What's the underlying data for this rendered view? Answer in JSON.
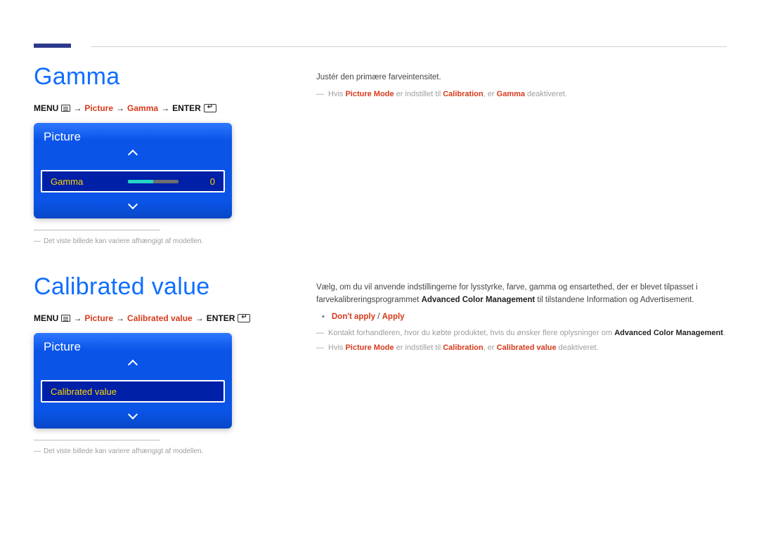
{
  "section_gamma": {
    "title": "Gamma",
    "breadcrumb": {
      "menu": "MENU",
      "picture": "Picture",
      "item": "Gamma",
      "enter": "ENTER"
    },
    "osd": {
      "header": "Picture",
      "row_label": "Gamma",
      "value": "0"
    },
    "note": "Det viste billede kan variere afhængigt af modellen.",
    "body": {
      "p1": "Justér den primære farveintensitet.",
      "fn_pre": "Hvis ",
      "fn_pm": "Picture Mode",
      "fn_mid1": " er indstillet til ",
      "fn_cal": "Calibration",
      "fn_mid2": ", er ",
      "fn_g": "Gamma",
      "fn_end": " deaktiveret."
    }
  },
  "section_calibrated": {
    "title": "Calibrated value",
    "breadcrumb": {
      "menu": "MENU",
      "picture": "Picture",
      "item": "Calibrated value",
      "enter": "ENTER"
    },
    "osd": {
      "header": "Picture",
      "row_label": "Calibrated value"
    },
    "note": "Det viste billede kan variere afhængigt af modellen.",
    "body": {
      "p1a": "Vælg, om du vil anvende indstillingerne for lysstyrke, farve, gamma og ensartethed, der er blevet tilpasset i farvekalibreringsprogrammet ",
      "p1_bold": "Advanced Color Management",
      "p1b": " til tilstandene Information og Advertisement.",
      "option_dont": "Don't apply",
      "option_sep": " / ",
      "option_apply": "Apply",
      "fn1_pre": "Kontakt forhandleren, hvor du købte produktet, hvis du ønsker flere oplysninger om ",
      "fn1_bold": "Advanced Color Management",
      "fn1_end": ".",
      "fn2_pre": "Hvis ",
      "fn2_pm": "Picture Mode",
      "fn2_mid1": " er indstillet til ",
      "fn2_cal": "Calibration",
      "fn2_mid2": ", er ",
      "fn2_cv": "Calibrated value",
      "fn2_end": " deaktiveret."
    }
  }
}
